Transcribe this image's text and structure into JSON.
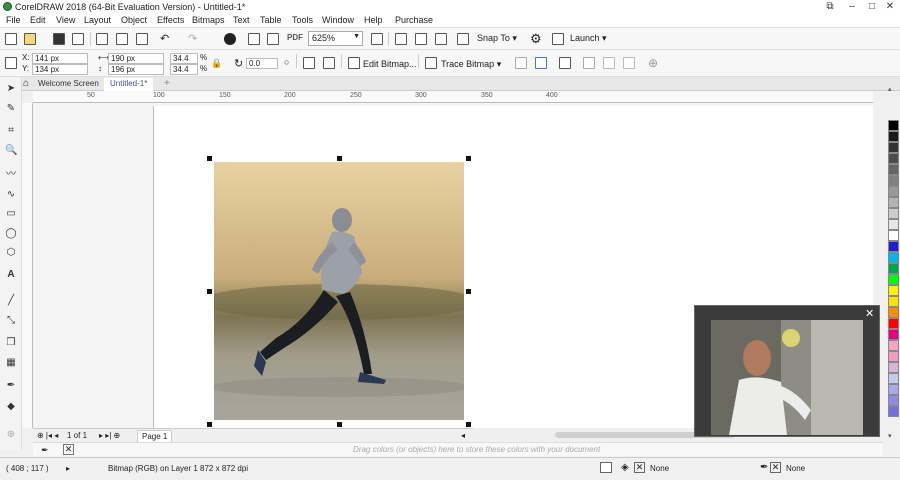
{
  "window": {
    "title": "CorelDRAW 2018 (64-Bit Evaluation Version) - Untitled-1*"
  },
  "menu": [
    "File",
    "Edit",
    "View",
    "Layout",
    "Object",
    "Effects",
    "Bitmaps",
    "Text",
    "Table",
    "Tools",
    "Window",
    "Help",
    "Purchase"
  ],
  "toolbar": {
    "zoom_value": "625%",
    "snap_label": "Snap To",
    "launch_label": "Launch",
    "pdf_label": "PDF"
  },
  "property_bar": {
    "x_value": "141 px",
    "y_value": "134 px",
    "width_value": "190 px",
    "height_value": "196 px",
    "scale_w": "34.4",
    "scale_h": "34.4",
    "pct": "%",
    "rotation_value": "0.0",
    "edit_bitmap_label": "Edit Bitmap...",
    "trace_bitmap_label": "Trace Bitmap"
  },
  "tabs": {
    "welcome": "Welcome Screen",
    "document": "Untitled-1*"
  },
  "ruler_h_labels": [
    "50",
    "100",
    "150",
    "200",
    "250",
    "300",
    "350",
    "400"
  ],
  "page_nav": {
    "counter": "1 of 1",
    "page_label": "Page 1"
  },
  "palette_hint": "Drag colors (or objects) here to store these colors with your document",
  "palette_colors": [
    "#000000",
    "#1a1a1a",
    "#333333",
    "#4d4d4d",
    "#666666",
    "#808080",
    "#999999",
    "#b3b3b3",
    "#cccccc",
    "#e6e6e6",
    "#ffffff",
    "#1e1ed2",
    "#00b5ef",
    "#00a651",
    "#00ff00",
    "#fff200",
    "#ffe100",
    "#ff8c00",
    "#ff0000",
    "#e6007e",
    "#f9a3c5",
    "#f49ac1",
    "#d6b5d6",
    "#c7c7f2",
    "#a9a9f0",
    "#8c8ce8",
    "#7070e0"
  ],
  "status": {
    "coords": "( 408 ; 117 )",
    "object_info": "Bitmap (RGB) on Layer 1 872 x 872 dpi",
    "fill_value": "None",
    "outline_value": "None"
  },
  "icons": [
    "app-logo-icon",
    "new-icon",
    "open-icon",
    "save-icon",
    "print-icon",
    "undo-icon",
    "redo-icon",
    "zoom-fit-icon",
    "settings-gear-icon",
    "pick-tool-icon",
    "shape-tool-icon",
    "crop-tool-icon",
    "zoom-tool-icon",
    "text-tool-icon",
    "fill-tool-icon",
    "close-icon"
  ]
}
